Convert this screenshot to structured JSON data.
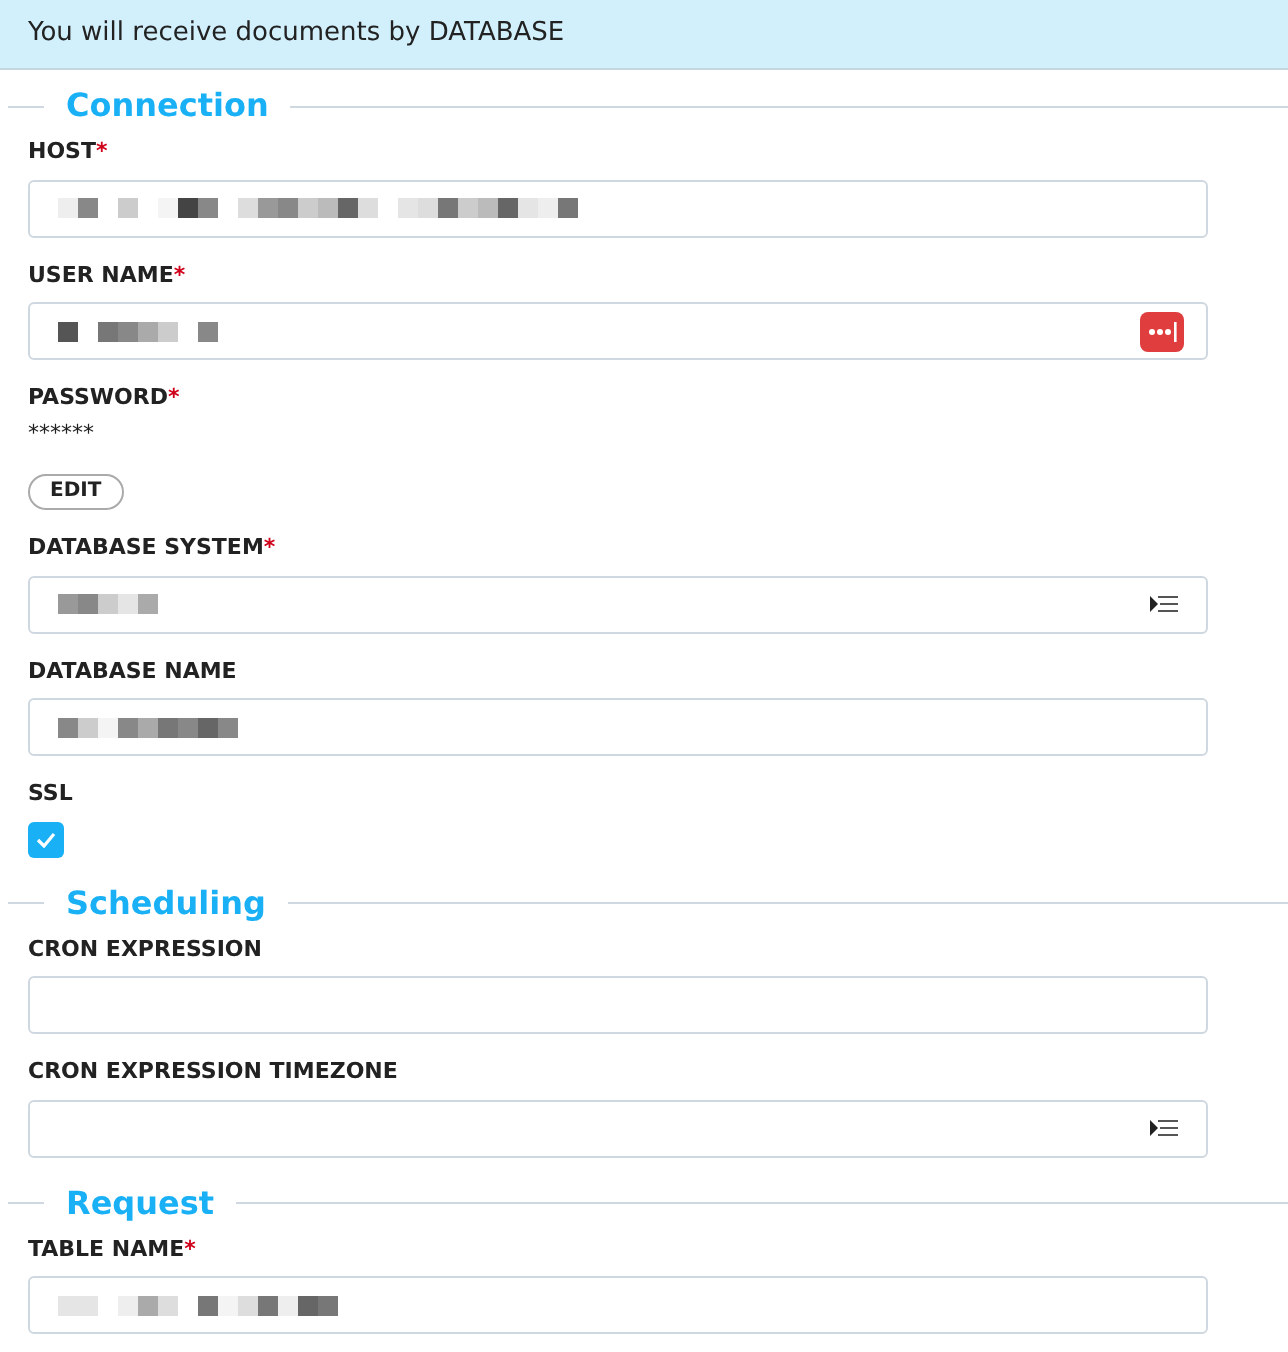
{
  "banner": {
    "text": "You will receive documents by DATABASE"
  },
  "sections": [
    {
      "title": "Connection",
      "fields": [
        {
          "kind": "text",
          "label": "HOST",
          "required_mark": "*",
          "redacted": true
        },
        {
          "kind": "text",
          "label": "USER NAME",
          "required_mark": "*",
          "redacted": true,
          "password_manager": true
        },
        {
          "kind": "password",
          "label": "PASSWORD",
          "required_mark": "*",
          "value": "******",
          "button": "EDIT"
        },
        {
          "kind": "select",
          "label": "DATABASE SYSTEM",
          "required_mark": "*",
          "redacted": true
        },
        {
          "kind": "text",
          "label": "DATABASE NAME",
          "redacted": true
        },
        {
          "kind": "checkbox",
          "label": "SSL",
          "checked": true
        }
      ]
    },
    {
      "title": "Scheduling",
      "fields": [
        {
          "kind": "text",
          "label": "CRON EXPRESSION",
          "redacted": false
        },
        {
          "kind": "select",
          "label": "CRON EXPRESSION TIMEZONE",
          "redacted": false
        }
      ]
    },
    {
      "title": "Request",
      "fields": [
        {
          "kind": "text",
          "label": "TABLE NAME",
          "required_mark": "*",
          "redacted": true
        }
      ]
    }
  ]
}
